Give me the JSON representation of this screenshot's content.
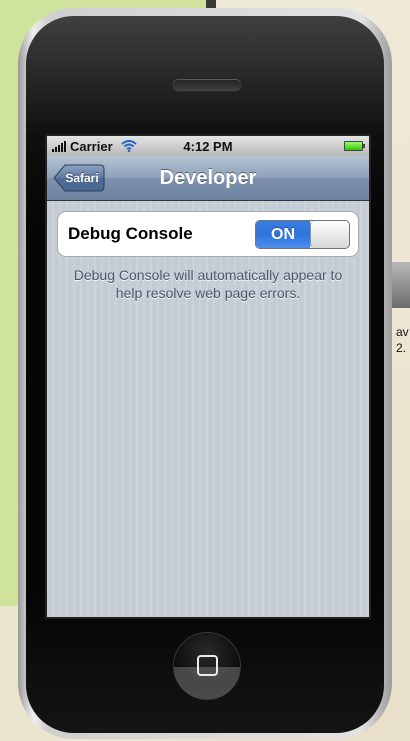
{
  "desktop": {
    "partial_icon_label": "av\n2."
  },
  "status_bar": {
    "carrier": "Carrier",
    "time": "4:12 PM"
  },
  "nav_bar": {
    "back_label": "Safari",
    "title": "Developer"
  },
  "settings": {
    "debug_console_label": "Debug Console",
    "debug_console_state": "ON",
    "debug_console_enabled": true,
    "footer_text": "Debug Console will automatically appear to help resolve web page errors."
  },
  "colors": {
    "switch_on_blue": "#3a7de1",
    "nav_bar_blue": "#7d91ab",
    "background_stripe": "#c5ccd4"
  },
  "icons": [
    "signal-bars-icon",
    "wifi-icon",
    "battery-icon",
    "back-arrow-icon",
    "home-square-icon"
  ]
}
